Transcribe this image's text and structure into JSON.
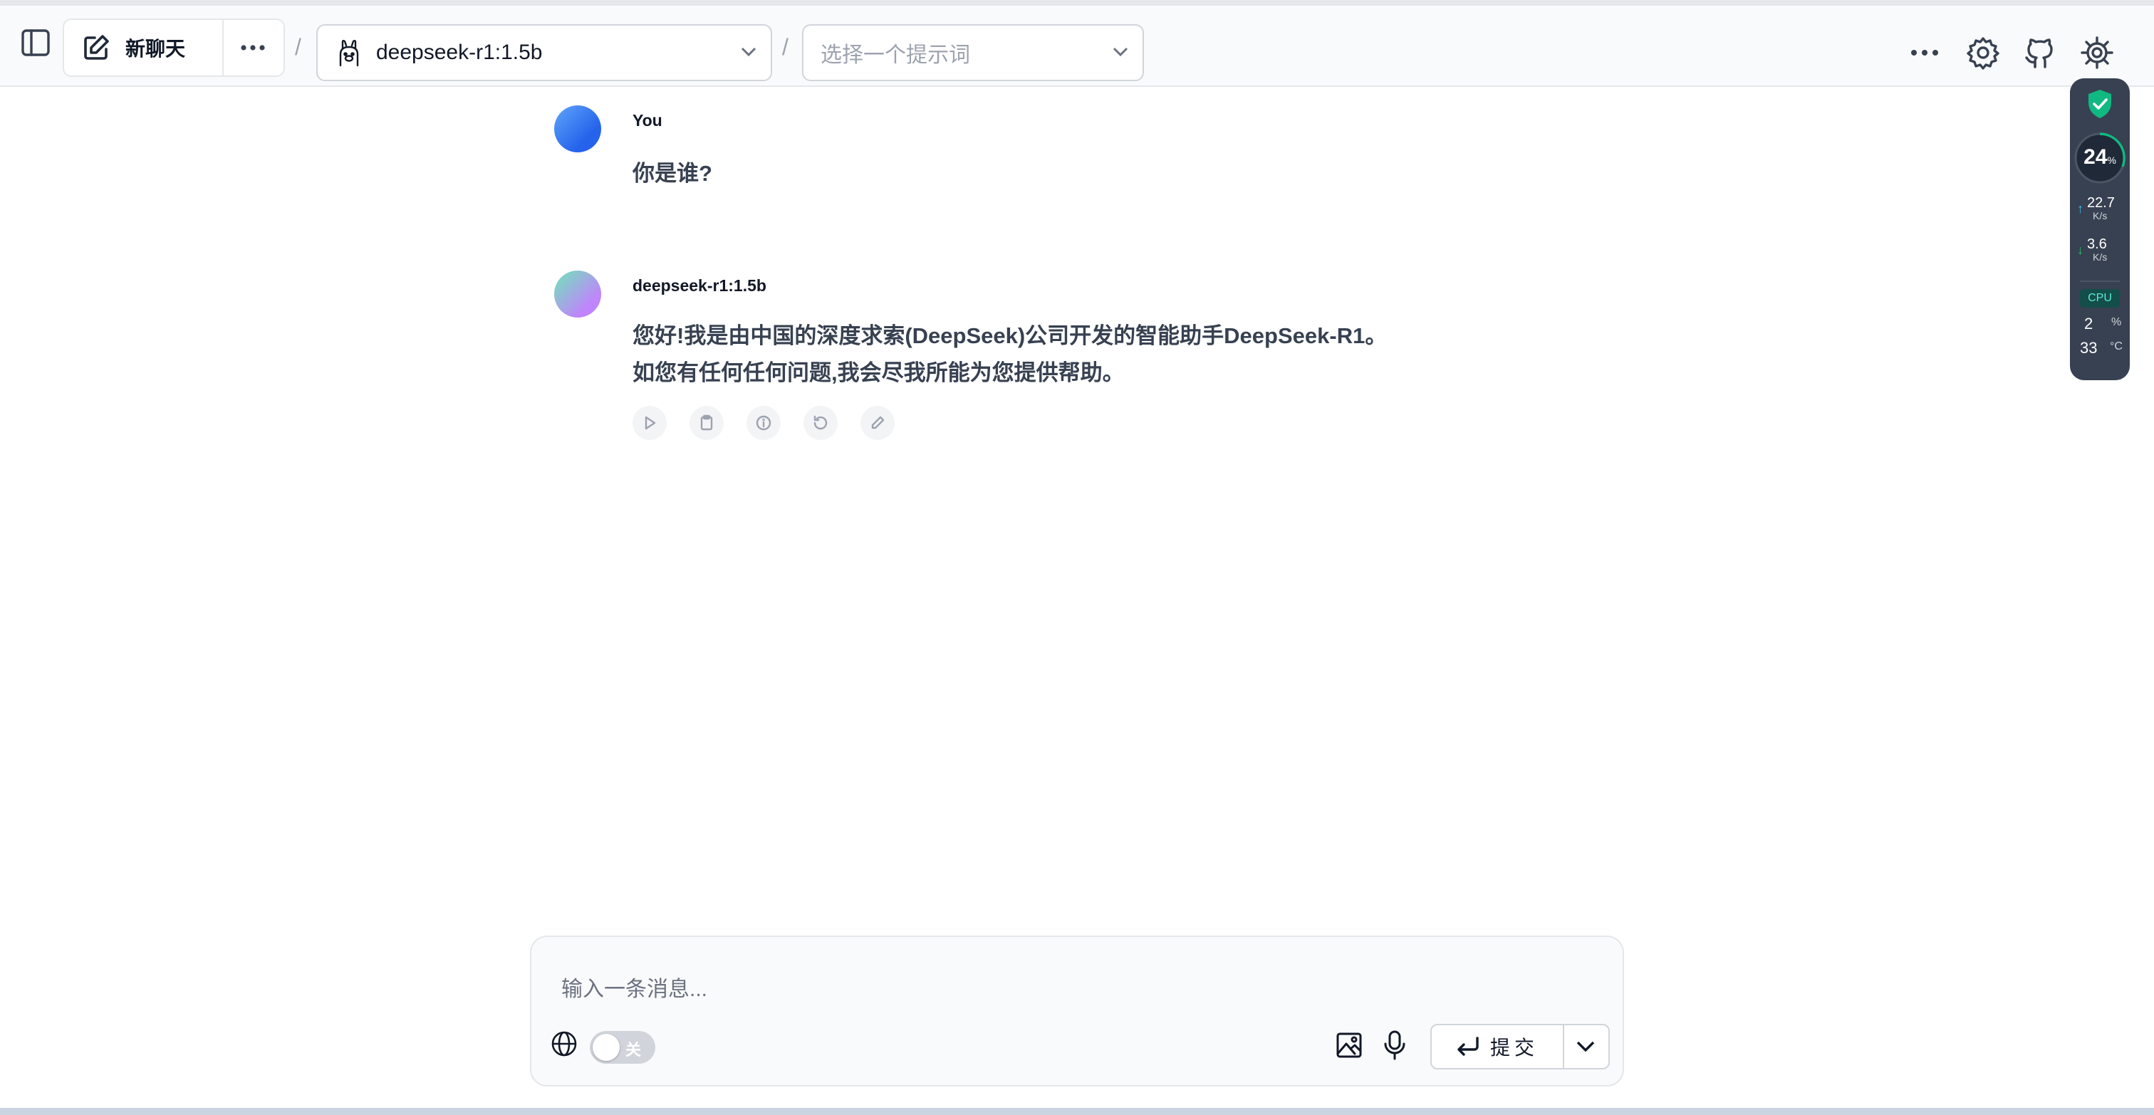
{
  "header": {
    "new_chat_label": "新聊天",
    "separator": "/",
    "model_selected": "deepseek-r1:1.5b",
    "prompt_placeholder": "选择一个提示词"
  },
  "icons": {
    "sidebar_toggle": "sidebar-toggle-icon",
    "new_chat": "edit-icon",
    "more": "ellipsis-icon",
    "model": "llama-icon",
    "chevron": "chevron-down-icon",
    "settings": "gear-icon",
    "github": "github-icon"
  },
  "messages": [
    {
      "author": "You",
      "text": "你是谁?"
    },
    {
      "author": "deepseek-r1:1.5b",
      "lines": [
        "您好!我是由中国的深度求索(DeepSeek)公司开发的智能助手DeepSeek-R1。",
        "如您有任何任何问题,我会尽我所能为您提供帮助。"
      ]
    }
  ],
  "message_actions": [
    "play-icon",
    "copy-icon",
    "info-icon",
    "regenerate-icon",
    "edit-icon"
  ],
  "composer": {
    "placeholder": "输入一条消息...",
    "web_search_toggle": "关",
    "submit_label": "提交"
  },
  "monitor": {
    "percent": "24",
    "percent_unit": "%",
    "upload_speed": "22.7",
    "download_speed": "3.6",
    "speed_unit": "K/s",
    "cpu_label": "CPU",
    "cpu_usage": "2",
    "cpu_usage_unit": "%",
    "temperature": "33",
    "temperature_unit": "°C"
  },
  "colors": {
    "user_avatar": "#3b82f6",
    "accent_green": "#10b981",
    "monitor_bg": "#374151"
  }
}
